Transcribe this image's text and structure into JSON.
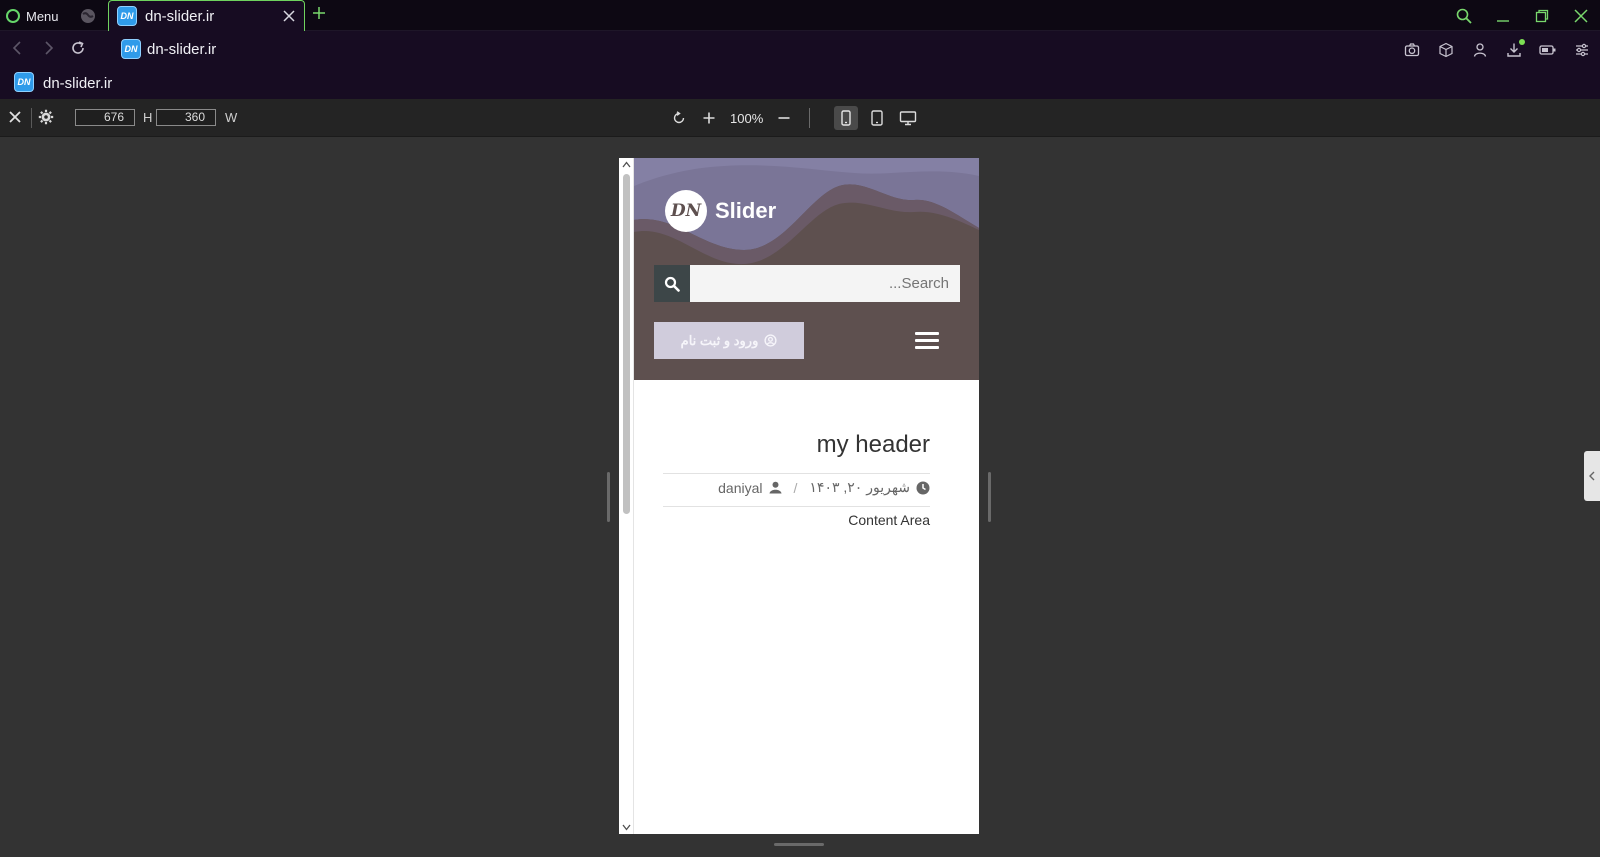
{
  "browser": {
    "menu_label": "Menu",
    "tab_title": "dn-slider.ir",
    "favicon_text": "DN",
    "address": "dn-slider.ir",
    "bookmark_label": "dn-slider.ir"
  },
  "devtools": {
    "height_value": "676",
    "height_label": "H",
    "width_value": "360",
    "width_label": "W",
    "zoom": "100%"
  },
  "site": {
    "logo_mark": "DN",
    "logo_text": "Slider",
    "search_placeholder": "Search...",
    "login_label": "ورود و ثبت نام",
    "post_title": "my header",
    "date": "شهریور ۲۰, ۱۴۰۳",
    "separator": "/",
    "author": "daniyal",
    "content": "Content Area"
  },
  "colors": {
    "accent": "#6fd35e",
    "header_bg": "#5e504f",
    "sky": "#7a7597",
    "login_btn": "#d0ccdc"
  }
}
